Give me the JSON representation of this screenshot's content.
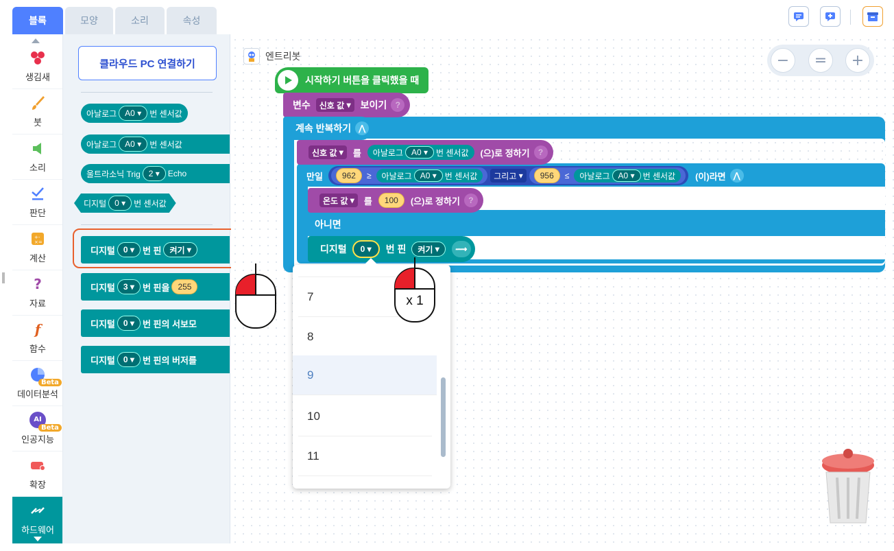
{
  "tabs": [
    "블록",
    "모양",
    "소리",
    "속성"
  ],
  "categories": [
    {
      "label": "생김새",
      "icon": "appearance-icon"
    },
    {
      "label": "붓",
      "icon": "brush-icon"
    },
    {
      "label": "소리",
      "icon": "sound-icon"
    },
    {
      "label": "판단",
      "icon": "judgement-icon"
    },
    {
      "label": "계산",
      "icon": "calculator-icon"
    },
    {
      "label": "자료",
      "icon": "question-icon"
    },
    {
      "label": "함수",
      "icon": "function-icon"
    },
    {
      "label": "데이터분석",
      "icon": "data-analysis-icon",
      "badge": "Beta"
    },
    {
      "label": "인공지능",
      "icon": "ai-icon",
      "badge": "Beta",
      "icon_text": "AI"
    },
    {
      "label": "확장",
      "icon": "extension-icon"
    },
    {
      "label": "하드웨어",
      "icon": "hardware-icon"
    }
  ],
  "palette": {
    "cloud_button": "클라우드 PC 연결하기",
    "analog1": {
      "a": "아날로그",
      "dd": "A0",
      "b": "번 센서값"
    },
    "analog2": {
      "a": "아날로그",
      "dd": "A0",
      "b": "번 센서값"
    },
    "ultra": {
      "a": "울트라소닉 Trig",
      "dd": "2",
      "b": "Echo"
    },
    "digital_sensor": {
      "a": "디지털",
      "dd": "0",
      "b": "번 센서값"
    },
    "pin_on": {
      "a": "디지털",
      "dd": "0",
      "b": "번 핀",
      "c": "켜기"
    },
    "pin_set": {
      "a": "디지털",
      "dd": "3",
      "b": "번 핀을",
      "n": "255"
    },
    "pin_servo": {
      "a": "디지털",
      "dd": "0",
      "b": "번 핀의 서보모"
    },
    "pin_buzzer": {
      "a": "디지털",
      "dd": "0",
      "b": "번 핀의 버저를"
    }
  },
  "workspace": {
    "object_name": "엔트리봇",
    "start": "시작하기 버튼을 클릭했을 때",
    "show_var": {
      "a": "변수",
      "dd": "신호 값",
      "b": "보이기"
    },
    "forever": "계속 반복하기",
    "set_signal": {
      "dd": "신호 값",
      "a": "를",
      "s": "아날로그",
      "sdd": "A0",
      "sb": "번 센서값",
      "c": "(으)로 정하기"
    },
    "if": {
      "a": "만일",
      "n1": "962",
      "op1": "≥",
      "s1": "아날로그",
      "sdd1": "A0",
      "sb1": "번 센서값",
      "and": "그리고",
      "n2": "956",
      "op2": "≤",
      "s2": "아날로그",
      "sdd2": "A0",
      "sb2": "번 센서값",
      "c": "(이)라면"
    },
    "set_temp": {
      "dd": "온도 값",
      "a": "를",
      "n": "100",
      "c": "(으)로 정하기"
    },
    "else": "아니면",
    "digital": {
      "a": "디지털",
      "dd": "0",
      "b": "번 핀",
      "c": "켜기"
    }
  },
  "dropdown_options": [
    "7",
    "8",
    "9",
    "10",
    "11"
  ],
  "selected_option": "9",
  "zoom": {
    "minus": "−",
    "reset": "=",
    "plus": "+"
  },
  "click_count": "x 1",
  "colors": {
    "primary": "#4f80ff",
    "hardware": "#00979d",
    "start": "#2db24a",
    "variable": "#a04ba8",
    "flow": "#1ea0d8",
    "number": "#ffd77a"
  }
}
